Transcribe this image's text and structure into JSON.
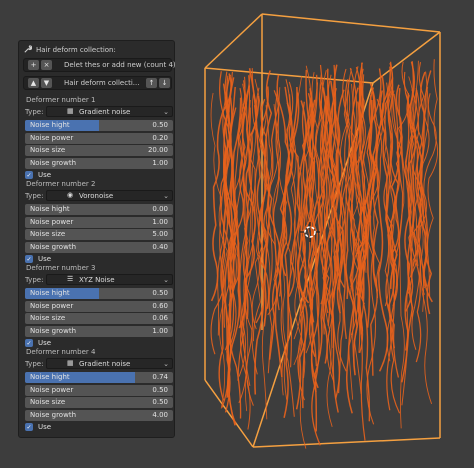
{
  "panel": {
    "title": "Hair deform collection:",
    "add_icon": "plus",
    "remove_icon": "x",
    "list_label": "Delet thes or add new (count 4)",
    "up_icon": "triangle-up",
    "down_icon": "triangle-down",
    "collection_name": "Hair deform collecti...",
    "move_up_icon": "arrow-up",
    "move_down_icon": "arrow-down",
    "type_label": "Type:",
    "use_label": "Use",
    "deformers": [
      {
        "title": "Deformer number 1",
        "type": "Gradient noise",
        "icon": "gradient",
        "noise_hight_label": "Noise hight",
        "noise_hight": "0.50",
        "noise_power_label": "Noise power",
        "noise_power": "0.20",
        "noise_size_label": "Noise size",
        "noise_size": "20.00",
        "noise_growth_label": "Noise growth",
        "noise_growth": "1.00",
        "use": true
      },
      {
        "title": "Deformer number 2",
        "type": "Voronoise",
        "icon": "voronoi",
        "noise_hight_label": "Noise hight",
        "noise_hight": "0.00",
        "noise_power_label": "Noise power",
        "noise_power": "1.00",
        "noise_size_label": "Noise size",
        "noise_size": "5.00",
        "noise_growth_label": "Noise growth",
        "noise_growth": "0.40",
        "use": true
      },
      {
        "title": "Deformer number 3",
        "type": "XYZ Noise",
        "icon": "list",
        "noise_hight_label": "Noise hight",
        "noise_hight": "0.50",
        "noise_power_label": "Noise power",
        "noise_power": "0.60",
        "noise_size_label": "Noise size",
        "noise_size": "0.06",
        "noise_growth_label": "Noise growth",
        "noise_growth": "1.00",
        "use": true
      },
      {
        "title": "Deformer number 4",
        "type": "Gradient noise",
        "icon": "gradient",
        "noise_hight_label": "Noise hight",
        "noise_hight": "0.74",
        "noise_power_label": "Noise power",
        "noise_power": "0.50",
        "noise_size_label": "Noise size",
        "noise_size": "0.50",
        "noise_growth_label": "Noise growth",
        "noise_growth": "4.00",
        "use": true
      }
    ]
  },
  "colors": {
    "accent": "#4a72b0",
    "hair": "#e8621c",
    "bounding_box": "#f5a040",
    "panel_bg": "#2b2b2b",
    "viewport_bg": "#3d3d3d"
  }
}
